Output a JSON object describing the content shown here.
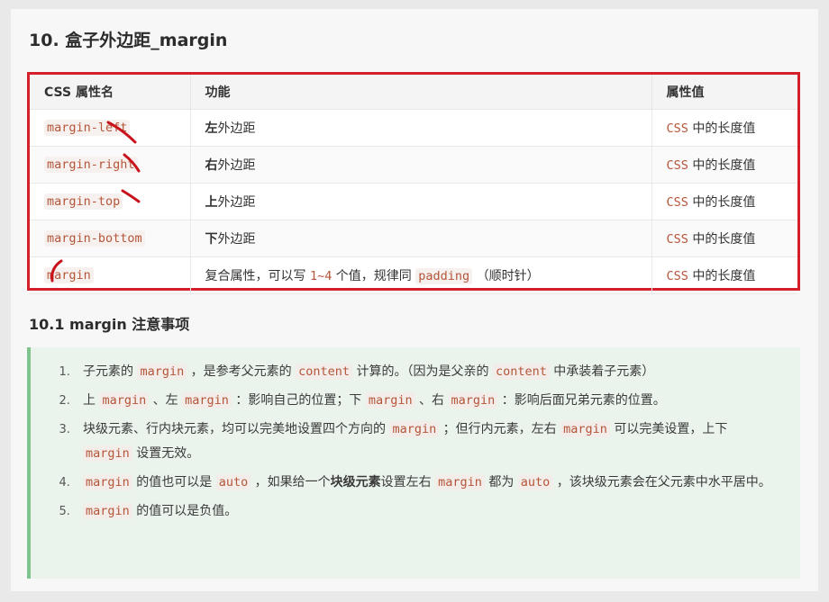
{
  "section_title": "10. 盒子外边距_margin",
  "table": {
    "headers": [
      "CSS 属性名",
      "功能",
      "属性值"
    ],
    "rows": [
      {
        "prop": "margin-left",
        "fn_bold": "左",
        "fn_rest": "外边距",
        "value_code": "CSS",
        "value_rest": " 中的长度值"
      },
      {
        "prop": "margin-right",
        "fn_bold": "右",
        "fn_rest": "外边距",
        "value_code": "CSS",
        "value_rest": " 中的长度值"
      },
      {
        "prop": "margin-top",
        "fn_bold": "上",
        "fn_rest": "外边距",
        "value_code": "CSS",
        "value_rest": " 中的长度值"
      },
      {
        "prop": "margin-bottom",
        "fn_bold": "下",
        "fn_rest": "外边距",
        "value_code": "CSS",
        "value_rest": " 中的长度值"
      },
      {
        "prop": "margin",
        "fn_a": "复合属性，可以写 ",
        "fn_code1": "1~4",
        "fn_b": " 个值，规律同 ",
        "fn_code2": "padding",
        "fn_c": " （顺时针）",
        "value_code": "CSS",
        "value_rest": " 中的长度值"
      }
    ]
  },
  "subsection_title": "10.1 margin 注意事项",
  "notes": {
    "n1": {
      "a": "子元素的 ",
      "c1": "margin",
      "b": " ，是参考父元素的 ",
      "c2": "content",
      "c": " 计算的。（因为是父亲的 ",
      "c3": "content",
      "d": " 中承装着子元素）"
    },
    "n2": {
      "a": "上 ",
      "c1": "margin",
      "b": " 、左 ",
      "c2": "margin",
      "c": " ：影响自己的位置；下 ",
      "c3": "margin",
      "d": " 、右 ",
      "c4": "margin",
      "e": " ：影响后面兄弟元素的位置。"
    },
    "n3": {
      "a": "块级元素、行内块元素，均可以完美地设置四个方向的 ",
      "c1": "margin",
      "b": " ；但行内元素，左右 ",
      "c2": "margin",
      "c": " 可以完美设置，上下 ",
      "c3": "margin",
      "d": " 设置无效。"
    },
    "n4": {
      "c1": "margin",
      "a": " 的值也可以是 ",
      "c2": "auto",
      "b": " ，如果给一个",
      "bold": "块级元素",
      "c": "设置左右 ",
      "c3": "margin",
      "d": " 都为 ",
      "c4": "auto",
      "e": " ，该块级元素会在父元素中水平居中。"
    },
    "n5": {
      "c1": "margin",
      "a": " 的值可以是负值。"
    }
  },
  "colors": {
    "highlight_border": "#d3202a",
    "note_border": "#7fc48f",
    "note_bg": "#eaf3ec",
    "code_text": "#b5553a"
  }
}
